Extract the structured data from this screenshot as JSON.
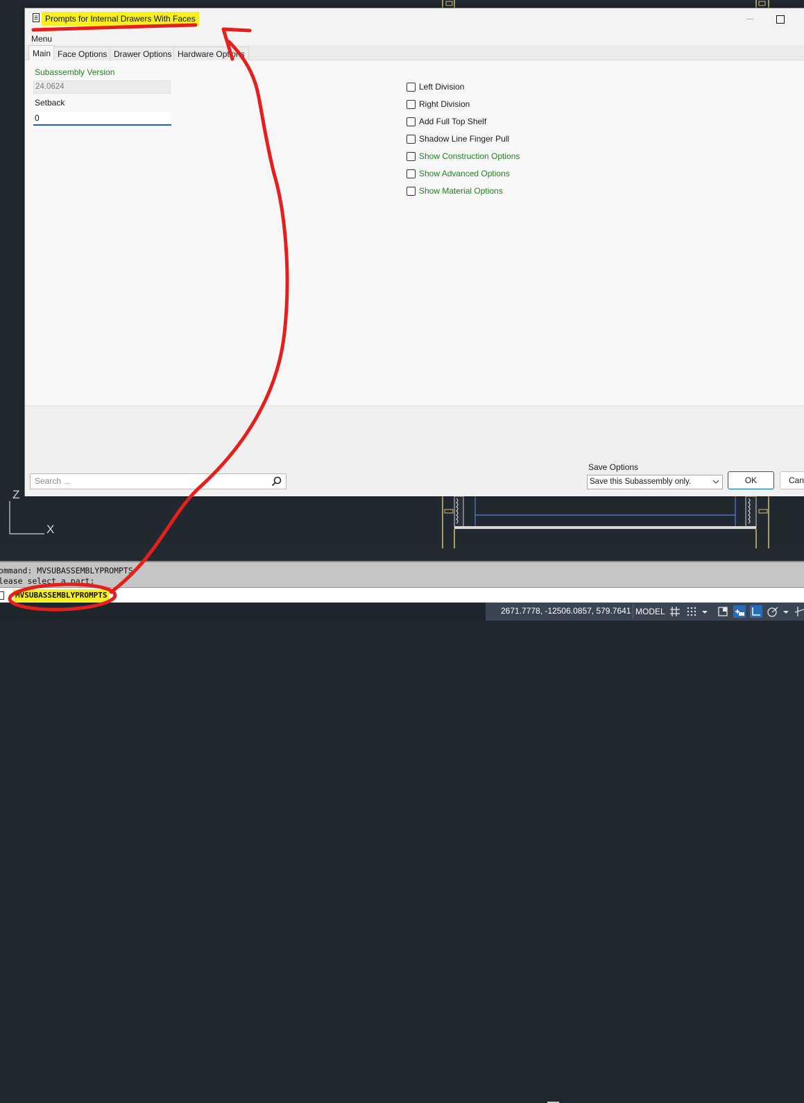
{
  "dialog": {
    "title": "Prompts for Internal Drawers With Faces",
    "menu": "Menu",
    "tabs": [
      "Main",
      "Face Options",
      "Drawer Options",
      "Hardware Options"
    ],
    "active_tab": "Main",
    "main": {
      "version_label": "Subassembly Version",
      "version_value": "24.0624",
      "setback_label": "Setback",
      "setback_value": "0",
      "checkboxes": [
        {
          "label": "Left Division",
          "checked": false,
          "color": "#1a1a1a"
        },
        {
          "label": "Right Division",
          "checked": false,
          "color": "#1a1a1a"
        },
        {
          "label": "Add Full Top Shelf",
          "checked": false,
          "color": "#1a1a1a"
        },
        {
          "label": "Shadow Line Finger Pull",
          "checked": false,
          "color": "#1a1a1a"
        },
        {
          "label": "Show Construction Options",
          "checked": false,
          "color": "#238223"
        },
        {
          "label": "Show Advanced Options",
          "checked": false,
          "color": "#238223"
        },
        {
          "label": "Show Material Options",
          "checked": false,
          "color": "#238223"
        }
      ]
    },
    "footer": {
      "search_placeholder": "Search ...",
      "save_options_label": "Save Options",
      "save_options_value": "Save this Subassembly only.",
      "ok_label": "OK",
      "cancel_label": "Cancel"
    }
  },
  "command_line": {
    "history": [
      "Command: MVSUBASSEMBLYPROMPTS",
      "Please select a part:"
    ],
    "current_input": "MVSUBASSEMBLYPROMPTS"
  },
  "status_bar": {
    "coordinates": "2671.7778, -12506.0857, 579.7641",
    "space": "MODEL"
  },
  "ucs": {
    "z_label": "Z",
    "x_label": "X"
  },
  "colors": {
    "highlight": "#f7f01c",
    "annotation": "#e3201b",
    "accent_green": "#238223",
    "cad_background": "#212830"
  }
}
